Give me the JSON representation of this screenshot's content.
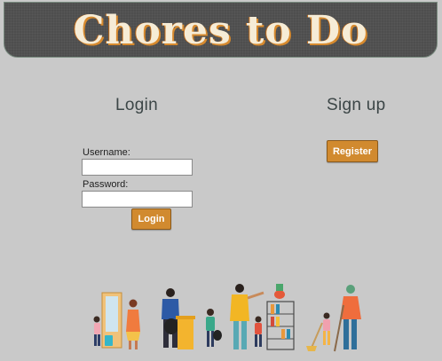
{
  "header": {
    "title": "Chores to Do"
  },
  "login": {
    "heading": "Login",
    "username_label": "Username:",
    "username_value": "",
    "password_label": "Password:",
    "password_value": "",
    "submit_label": "Login"
  },
  "signup": {
    "heading": "Sign up",
    "register_label": "Register"
  },
  "colors": {
    "background": "#c9c9c9",
    "header": "#4e4e4e",
    "accent_button": "#d18a2f",
    "heading_text": "#3c4647"
  },
  "illustration": {
    "icon": "family-doing-chores-illustration"
  }
}
